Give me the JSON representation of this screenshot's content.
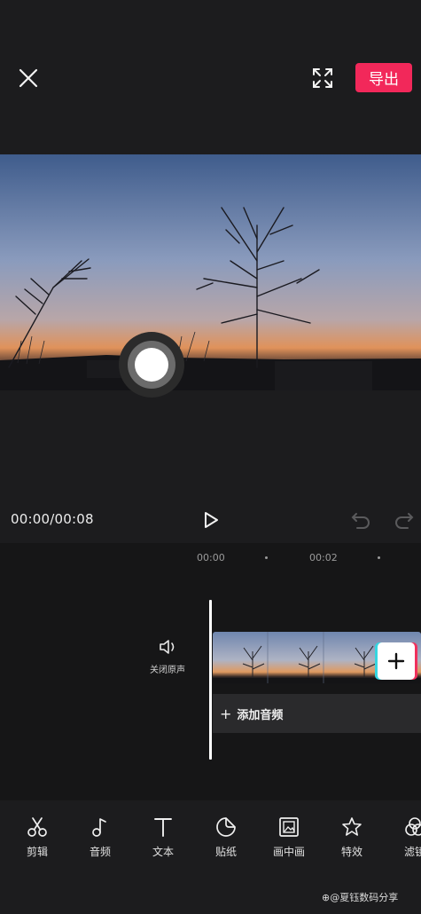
{
  "top_bar": {
    "export_label": "导出"
  },
  "playback": {
    "time": "00:00/00:08"
  },
  "timeline": {
    "ruler": [
      "00:00",
      "00:02"
    ],
    "mute_label": "关闭原声",
    "add_audio_plus": "+",
    "add_audio_label": "添加音频",
    "add_clip_symbol": "+"
  },
  "toolbar": {
    "items": [
      {
        "label": "剪辑",
        "icon": "scissors-icon"
      },
      {
        "label": "音频",
        "icon": "music-note-icon"
      },
      {
        "label": "文本",
        "icon": "text-icon"
      },
      {
        "label": "贴纸",
        "icon": "sticker-icon"
      },
      {
        "label": "画中画",
        "icon": "picture-in-picture-icon"
      },
      {
        "label": "特效",
        "icon": "effects-star-icon"
      },
      {
        "label": "滤镜",
        "icon": "filter-icon"
      }
    ]
  },
  "watermark": "⊕@夏钰数码分享",
  "colors": {
    "background": "#1c1c1e",
    "accent": "#f2285a",
    "timeline_bg": "#161617"
  }
}
